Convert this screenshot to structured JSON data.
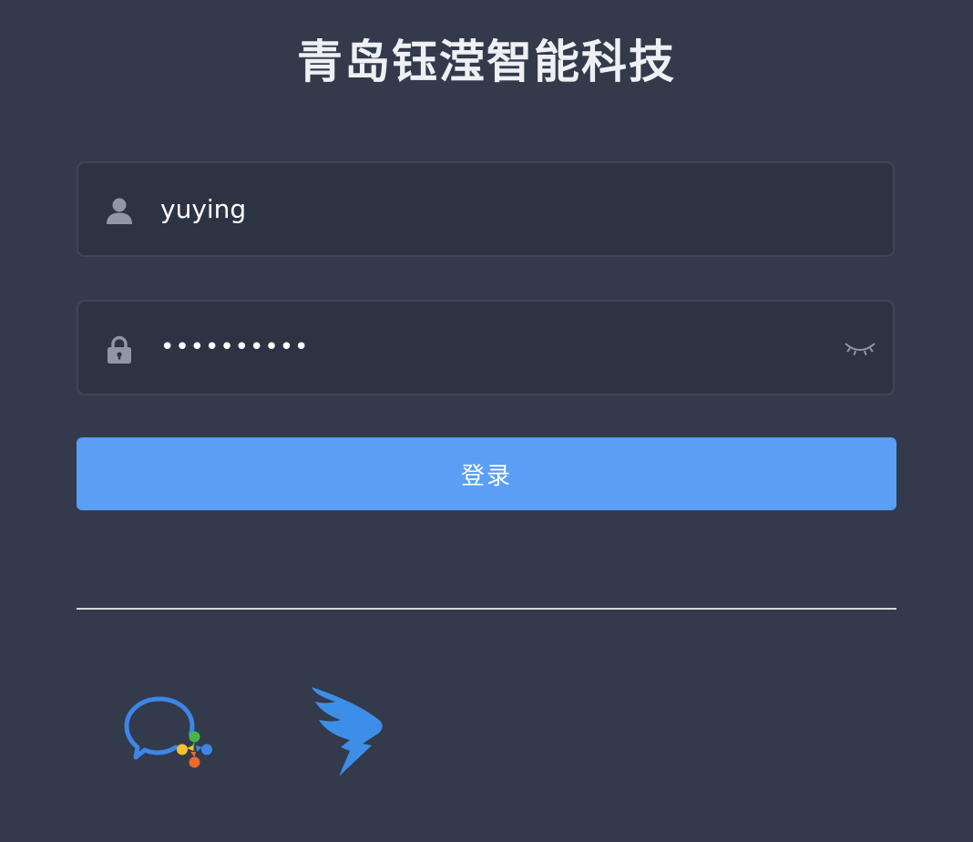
{
  "header": {
    "title": "青岛钰滢智能科技"
  },
  "form": {
    "username": {
      "value": "yuying",
      "icon": "user-icon"
    },
    "password": {
      "value": "••••••••••",
      "icon": "lock-icon",
      "toggle_icon": "eye-closed-icon"
    },
    "login_label": "登录"
  },
  "sso": {
    "items": [
      {
        "icon": "wecom-icon"
      },
      {
        "icon": "dingtalk-icon"
      }
    ]
  },
  "colors": {
    "background": "#323a4b",
    "field_background": "#2c3444",
    "primary": "#5a9ef5"
  }
}
